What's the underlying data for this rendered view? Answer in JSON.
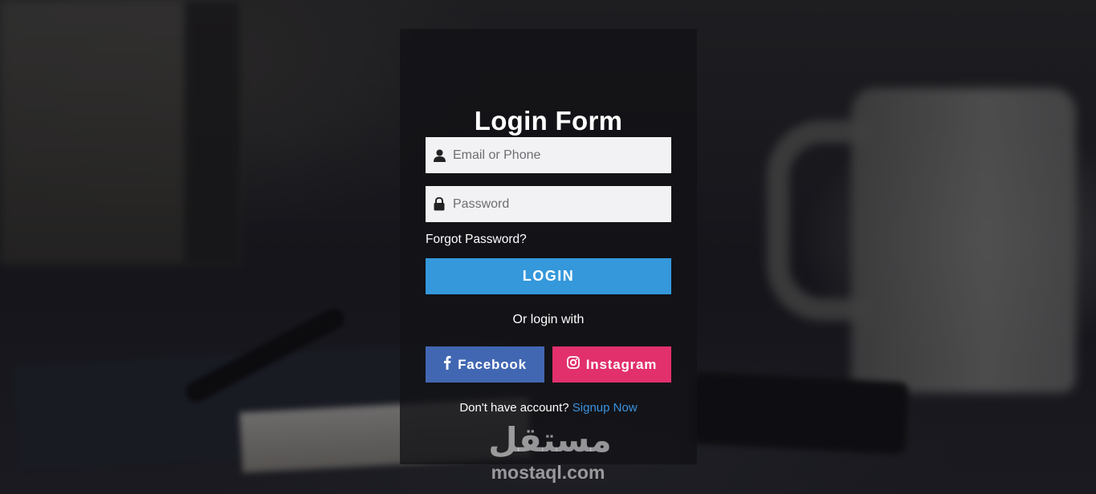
{
  "form": {
    "title": "Login Form",
    "email": {
      "placeholder": "Email or Phone",
      "value": "",
      "icon": "user-icon"
    },
    "password": {
      "placeholder": "Password",
      "value": "",
      "icon": "lock-icon"
    },
    "forgot_label": "Forgot Password?",
    "login_label": "LOGIN",
    "or_text": "Or login with",
    "facebook": {
      "label": "Facebook",
      "icon": "facebook-icon",
      "color": "#4267b2"
    },
    "instagram": {
      "label": "Instagram",
      "icon": "instagram-icon",
      "color": "#e1306c"
    },
    "signup_prompt": "Don't have account?",
    "signup_link": "Signup Now"
  },
  "watermark": {
    "arabic": "مستقل",
    "latin": "mostaql.com"
  },
  "colors": {
    "accent": "#3498db",
    "link": "#3a93e0"
  }
}
